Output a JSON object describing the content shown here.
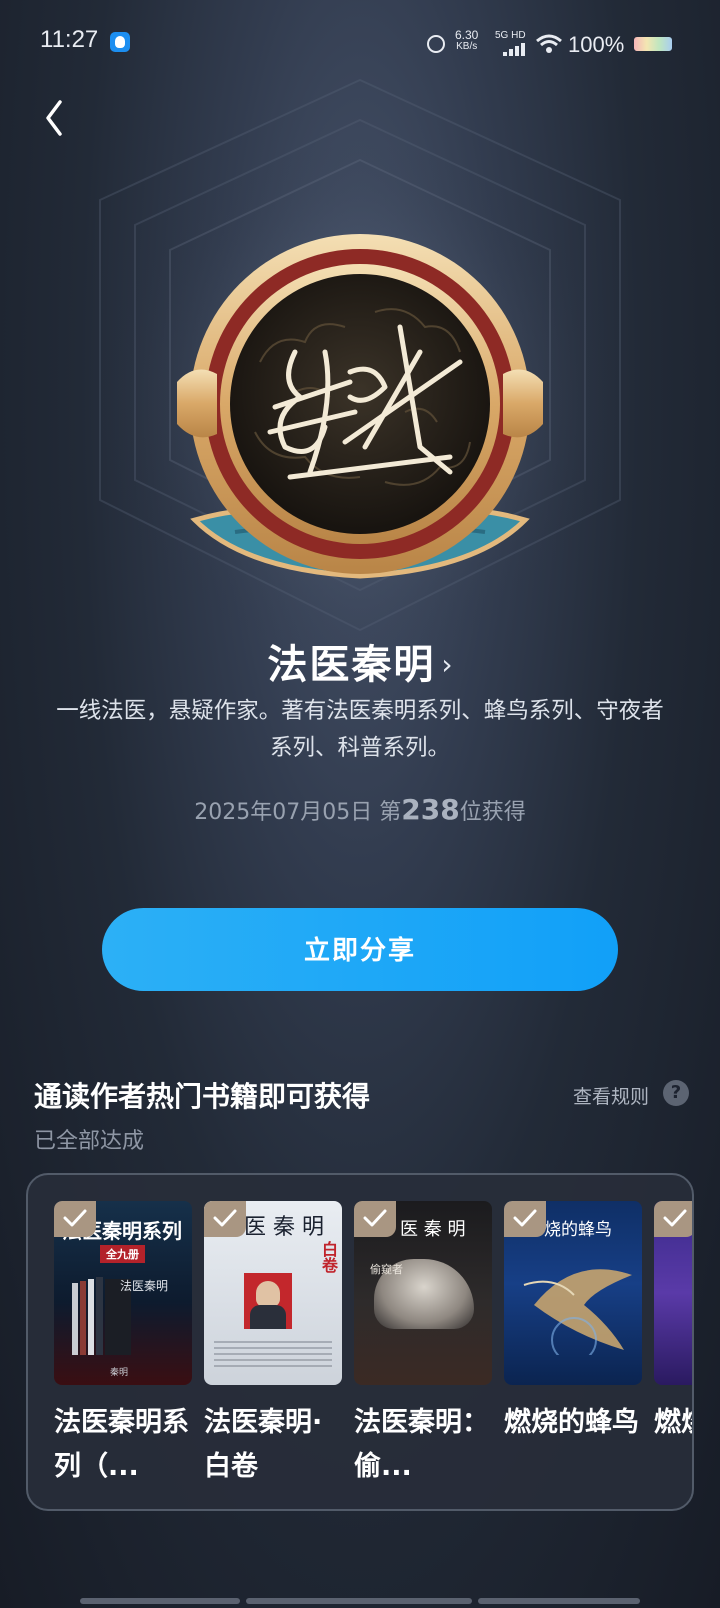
{
  "status_bar": {
    "time": "11:27",
    "net_speed_value": "6.30",
    "net_speed_unit": "KB/s",
    "signal_label": "5G HD",
    "battery": "100%"
  },
  "author": {
    "name": "法医秦明",
    "description": "一线法医，悬疑作家。著有法医秦明系列、蜂鸟系列、守夜者系列、科普系列。",
    "earned_date": "2025年07月05日",
    "rank_prefix": "第",
    "rank_number": "238",
    "rank_suffix": "位获得"
  },
  "share_button": "立即分享",
  "section": {
    "title": "通读作者热门书籍即可获得",
    "rules_link": "查看规则",
    "help_symbol": "?",
    "progress": "已全部达成"
  },
  "books": [
    {
      "title": "法医秦明系列（...",
      "cover_text": "法医秦明系列",
      "cover_sub": "全九册",
      "cover_brand": "法医秦明",
      "cover_bottom": "秦明"
    },
    {
      "title": "法医秦明·白卷",
      "cover_text": "医 秦 明",
      "cover_sub": "白卷"
    },
    {
      "title": "法医秦明：偷...",
      "cover_text": "医 秦 明",
      "cover_sub": "偷窥者"
    },
    {
      "title": "燃烧的蜂鸟",
      "cover_text": "烧的蜂鸟"
    },
    {
      "title": "燃烧的蜂鸟",
      "cover_text": ""
    }
  ],
  "colors": {
    "accent_blue": "#1ea6f7",
    "check_badge": "#a99682",
    "badge_gold": "#e3b97d",
    "badge_red": "#8e2a25",
    "badge_teal": "#3a8fa6"
  }
}
